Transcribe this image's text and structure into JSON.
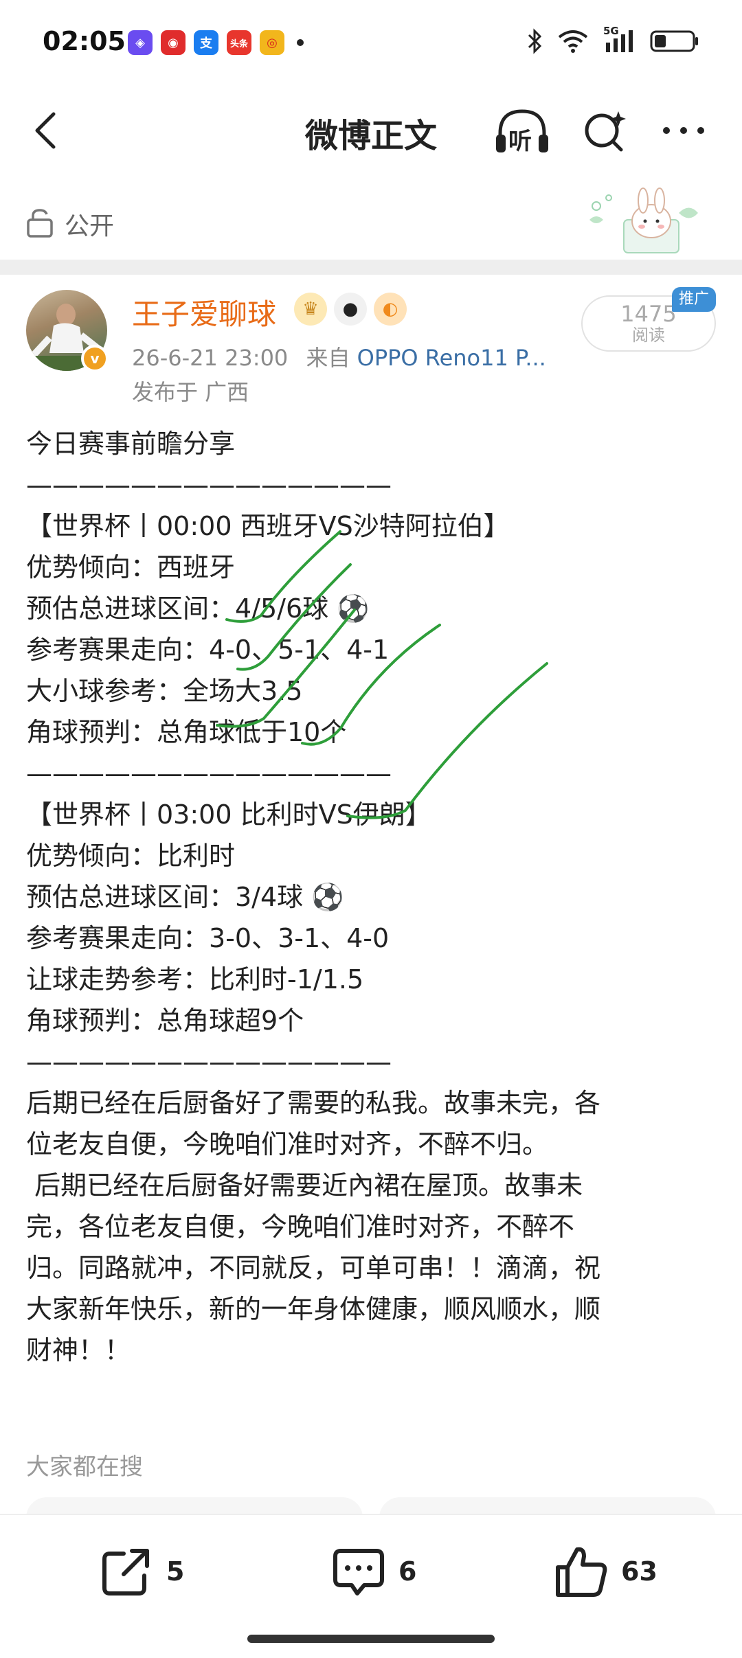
{
  "status_bar": {
    "time": "02:05",
    "network": "5G",
    "app_icons": [
      "shield-app-icon",
      "netease-music-icon",
      "alipay-icon",
      "toutiao-icon",
      "weibo-icon"
    ],
    "toutiao_text": "头条"
  },
  "nav": {
    "title": "微博正文",
    "listen_label": "听"
  },
  "visibility": {
    "label": "公开"
  },
  "author": {
    "name": "王子爱聊球",
    "verified_mark": "v",
    "timestamp": "26-6-21 23:00",
    "source_prefix": "来自",
    "source": "OPPO Reno11 P...",
    "location": "发布于 广西",
    "read_count": "1475",
    "read_label": "阅读",
    "promo_tag": "推广"
  },
  "post": {
    "lines": [
      "今日赛事前瞻分享",
      "",
      "——————————————",
      "【世界杯丨00:00 西班牙VS沙特阿拉伯】",
      "优势倾向：西班牙",
      "预估总进球区间：4/5/6球 ⚽",
      "参考赛果走向：4-0、5-1、4-1",
      "大小球参考：全场大3.5",
      "角球预判：总角球低于10个",
      "——————————————",
      "【世界杯丨03:00 比利时VS伊朗】",
      "优势倾向：比利时",
      "预估总进球区间：3/4球 ⚽",
      "参考赛果走向：3-0、3-1、4-0",
      "让球走势参考：比利时-1/1.5",
      "角球预判：总角球超9个",
      "——————————————",
      "后期已经在后厨备好了需要的私我。故事未完，各",
      "位老友自便，今晚咱们准时对齐，不醉不归。",
      " 后期已经在后厨备好需要近內裙在屋顶。故事未",
      "完，各位老友自便，今晚咱们准时对齐，不醉不",
      "归。同路就冲，不同就反，可单可串！！滴滴，祝",
      "大家新年快乐，新的一年身体健康，顺风顺水，顺",
      "财神！！"
    ]
  },
  "hot_search": {
    "label": "大家都在搜"
  },
  "actions": {
    "share_count": "5",
    "comment_count": "6",
    "like_count": "63"
  },
  "colors": {
    "author_name": "#e86b17",
    "source_link": "#3a6ea5",
    "promo_tag": "#3d8fd6",
    "handwriting": "#2e9e3a"
  }
}
